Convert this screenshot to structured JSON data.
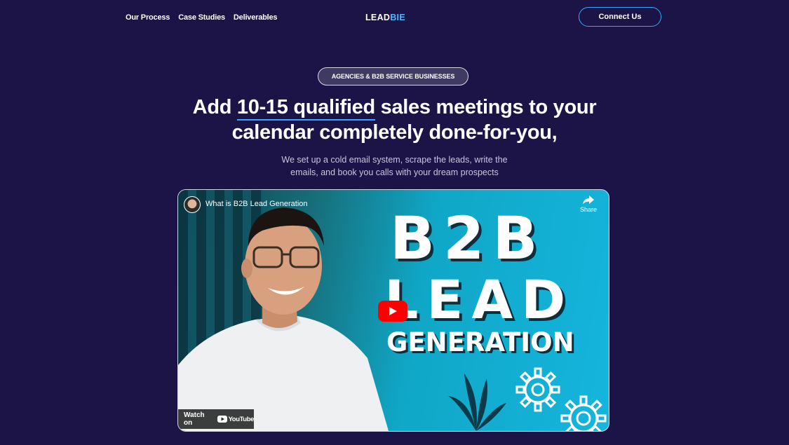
{
  "nav": {
    "links": [
      "Our Process",
      "Case Studies",
      "Deliverables"
    ],
    "logo_a": "LEAD",
    "logo_b": "BIE",
    "cta": "Connect Us"
  },
  "hero": {
    "badge": "AGENCIES & B2B SERVICE BUSINESSES",
    "headline_pre": "Add ",
    "headline_highlight": "10-15 qualified",
    "headline_mid": " sales meetings to your",
    "headline_line2": "calendar completely done-for-you,",
    "sub_line1": "We set up a cold email system, scrape the leads, write the",
    "sub_line2": "emails, and book you calls with your dream prospects"
  },
  "video": {
    "title": "What is B2B Lead Generation",
    "share_label": "Share",
    "thumb_line1": "B2B",
    "thumb_line2": "LEAD",
    "thumb_line3": "GENERATION",
    "watch_on": "Watch on",
    "youtube": "YouTube"
  },
  "colors": {
    "background": "#1c1446",
    "accent": "#3aa6ff",
    "play": "#ff0000"
  }
}
